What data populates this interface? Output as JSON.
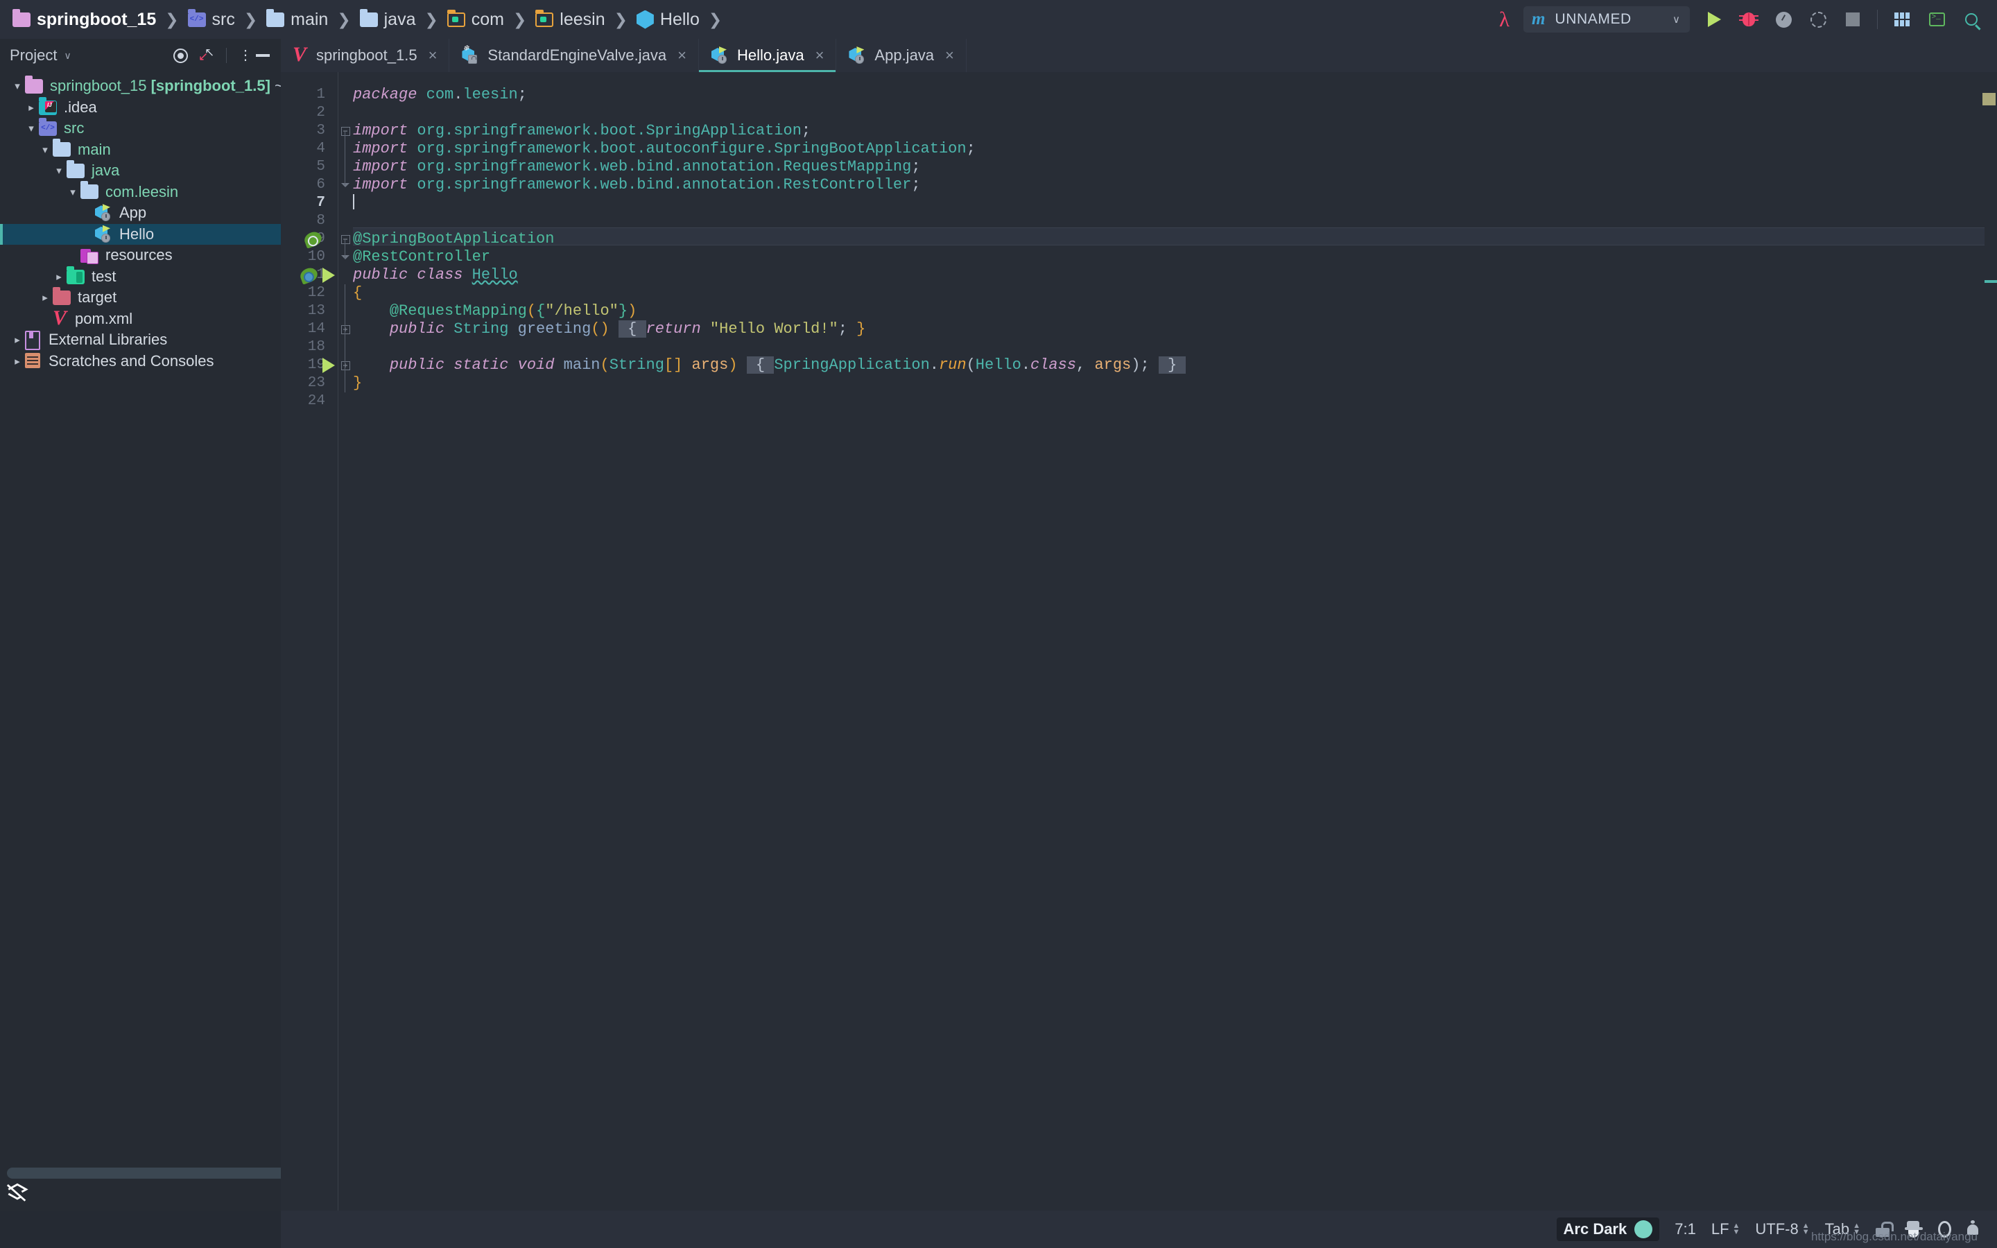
{
  "window": {
    "theme_name": "Arc Dark",
    "watermark": "https://blog.csdn.net/dataiyangu"
  },
  "breadcrumb": {
    "items": [
      {
        "label": "springboot_15",
        "icon": "project-folder-icon",
        "sep": "❯"
      },
      {
        "label": "src",
        "icon": "source-folder-icon",
        "sep": "❯"
      },
      {
        "label": "main",
        "icon": "folder-icon",
        "sep": "❯"
      },
      {
        "label": "java",
        "icon": "folder-icon",
        "sep": "❯"
      },
      {
        "label": "com",
        "icon": "package-folder-icon",
        "sep": "❯"
      },
      {
        "label": "leesin",
        "icon": "package-folder-icon",
        "sep": "❯"
      },
      {
        "label": "Hello",
        "icon": "java-class-icon",
        "sep": "❯"
      }
    ]
  },
  "toolbar": {
    "lambda_icon": "lambda-icon",
    "run_config": {
      "icon_letter": "m",
      "label": "UNNAMED",
      "chevron": "∨"
    },
    "buttons": [
      {
        "name": "run-button",
        "icon": "play-icon"
      },
      {
        "name": "debug-button",
        "icon": "bug-icon"
      },
      {
        "name": "profile-button",
        "icon": "profiler-icon"
      },
      {
        "name": "coverage-button",
        "icon": "coverage-icon"
      },
      {
        "name": "stop-button",
        "icon": "stop-icon"
      },
      {
        "name": "layout-button",
        "icon": "grid-icon"
      },
      {
        "name": "terminal-button",
        "icon": "terminal-icon"
      },
      {
        "name": "search-button",
        "icon": "search-icon"
      }
    ]
  },
  "project_panel": {
    "title": "Project",
    "chevron": "∨",
    "tools": [
      {
        "name": "locate-file-button",
        "icon": "target-icon"
      },
      {
        "name": "collapse-all-button",
        "icon": "collapse-arrows-icon"
      },
      {
        "name": "options-button",
        "icon": "kebab-menu-icon"
      },
      {
        "name": "hide-panel-button",
        "icon": "minimize-icon"
      }
    ],
    "tree": [
      {
        "indent": 0,
        "arrow": "open",
        "icon": "project-folder-icon",
        "label": "springboot_15 ",
        "bold": "[springboot_1.5]",
        "dim": " ~/intellij-idea-workspace/s",
        "type": "folder"
      },
      {
        "indent": 1,
        "arrow": "closed",
        "icon": "idea-folder-icon",
        "label": ".idea",
        "type": "file"
      },
      {
        "indent": 1,
        "arrow": "open",
        "icon": "source-folder-icon",
        "label": "src",
        "type": "folder"
      },
      {
        "indent": 2,
        "arrow": "open",
        "icon": "folder-icon",
        "label": "main",
        "type": "folder"
      },
      {
        "indent": 3,
        "arrow": "open",
        "icon": "folder-icon",
        "label": "java",
        "type": "folder"
      },
      {
        "indent": 4,
        "arrow": "open",
        "icon": "folder-icon",
        "label": "com.leesin",
        "type": "folder"
      },
      {
        "indent": 5,
        "arrow": "none",
        "icon": "java-class-icon",
        "label": "App",
        "type": "file"
      },
      {
        "indent": 5,
        "arrow": "none",
        "icon": "java-class-icon",
        "label": "Hello",
        "type": "file",
        "selected": true
      },
      {
        "indent": 4,
        "arrow": "none",
        "icon": "resources-folder-icon",
        "label": "resources",
        "type": "file"
      },
      {
        "indent": 3,
        "arrow": "closed",
        "icon": "test-folder-icon",
        "label": "test",
        "type": "file"
      },
      {
        "indent": 2,
        "arrow": "closed",
        "icon": "target-folder-icon",
        "label": "target",
        "type": "file"
      },
      {
        "indent": 2,
        "arrow": "none",
        "icon": "maven-pom-icon",
        "label": "pom.xml",
        "type": "file"
      },
      {
        "indent": 0,
        "arrow": "closed",
        "icon": "library-icon",
        "label": "External Libraries",
        "type": "file"
      },
      {
        "indent": 0,
        "arrow": "closed",
        "icon": "scratches-icon",
        "label": "Scratches and Consoles",
        "type": "file"
      }
    ]
  },
  "editor": {
    "tabs": [
      {
        "label": "springboot_1.5",
        "icon": "maven-pom-icon",
        "close": "×",
        "active": false
      },
      {
        "label": "StandardEngineValve.java",
        "icon": "java-class-locked-icon",
        "close": "×",
        "active": false
      },
      {
        "label": "Hello.java",
        "icon": "java-class-icon",
        "close": "×",
        "active": true
      },
      {
        "label": "App.java",
        "icon": "java-class-icon",
        "close": "×",
        "active": false
      }
    ],
    "line_numbers": [
      "1",
      "2",
      "3",
      "4",
      "5",
      "6",
      "7",
      "8",
      "9",
      "10",
      "11",
      "12",
      "13",
      "14",
      "18",
      "19",
      "23",
      "24"
    ],
    "current_line_index": 6,
    "code_lines": [
      {
        "n": "1",
        "html": "<span class=\"kw\">package</span> <span class=\"id\">com</span><span class=\"punc\">.</span><span class=\"id\">leesin</span><span class=\"punc\">;</span>"
      },
      {
        "n": "2",
        "html": ""
      },
      {
        "n": "3",
        "html": "<span class=\"kw\">import</span> <span class=\"id\">org.springframework.boot.SpringApplication</span><span class=\"punc\">;</span>"
      },
      {
        "n": "4",
        "html": "<span class=\"kw\">import</span> <span class=\"id\">org.springframework.boot.autoconfigure.SpringBootApplication</span><span class=\"punc\">;</span>"
      },
      {
        "n": "5",
        "html": "<span class=\"kw\">import</span> <span class=\"id\">org.springframework.web.bind.annotation.RequestMapping</span><span class=\"punc\">;</span>"
      },
      {
        "n": "6",
        "html": "<span class=\"kw\">import</span> <span class=\"id\">org.springframework.web.bind.annotation.RestController</span><span class=\"punc\">;</span>"
      },
      {
        "n": "7",
        "html": "<span class=\"caret\"></span>"
      },
      {
        "n": "8",
        "html": ""
      },
      {
        "n": "9",
        "html": "<span class=\"ann\">@SpringBootApplication</span>"
      },
      {
        "n": "10",
        "html": "<span class=\"ann\">@RestController</span>"
      },
      {
        "n": "11",
        "html": "<span class=\"kw\">public</span> <span class=\"kw\">class</span> <span class=\"typ warnu\">Hello</span>"
      },
      {
        "n": "12",
        "html": "<span class=\"brk\">{</span>"
      },
      {
        "n": "13",
        "html": "    <span class=\"ann\">@RequestMapping</span><span class=\"brk\">(</span><span class=\"ann\">{</span><span class=\"str\">\"/hello\"</span><span class=\"ann\">}</span><span class=\"brk\">)</span>"
      },
      {
        "n": "14",
        "html": "    <span class=\"kw\">public</span> <span class=\"typ\">String</span> <span class=\"mth\">greeting</span><span class=\"brk\">()</span> <span class=\"bracehl\"> { </span><span class=\"kw\">return</span> <span class=\"str\">\"Hello World!\"</span><span class=\"punc\">;</span> <span class=\"brk\">}</span>"
      },
      {
        "n": "18",
        "html": ""
      },
      {
        "n": "19",
        "html": "    <span class=\"kw\">public</span> <span class=\"kw\">static</span> <span class=\"kw\">void</span> <span class=\"mth\">main</span><span class=\"brk\">(</span><span class=\"typ\">String</span><span class=\"brk\">[]</span> <span class=\"par\">args</span><span class=\"brk\">)</span> <span class=\"bracehl\"> { </span><span class=\"id\">SpringApplication</span><span class=\"punc\">.</span><span class=\"stat\">run</span><span class=\"punc\">(</span><span class=\"typ\">Hello</span><span class=\"punc\">.</span><span class=\"kw\">class</span><span class=\"punc\">, </span><span class=\"par\">args</span><span class=\"punc\">);</span> <span class=\"bracehl\"> } </span>"
      },
      {
        "n": "23",
        "html": "<span class=\"brk\">}</span>"
      },
      {
        "n": "24",
        "html": ""
      }
    ],
    "gutter_icons": [
      {
        "line": "9",
        "name": "spring-config-icon"
      },
      {
        "line": "11",
        "name": "spring-bean-icon"
      },
      {
        "line": "11",
        "name": "run-gutter-icon"
      },
      {
        "line": "19",
        "name": "run-gutter-icon"
      }
    ]
  },
  "status_bar": {
    "theme": "Arc Dark",
    "caret_position": "7:1",
    "line_separator": "LF",
    "encoding": "UTF-8",
    "indent": "Tab",
    "icons": [
      {
        "name": "lock-icon"
      },
      {
        "name": "inspector-hat-icon"
      },
      {
        "name": "magnifier-icon"
      },
      {
        "name": "notification-bell-icon"
      }
    ]
  }
}
